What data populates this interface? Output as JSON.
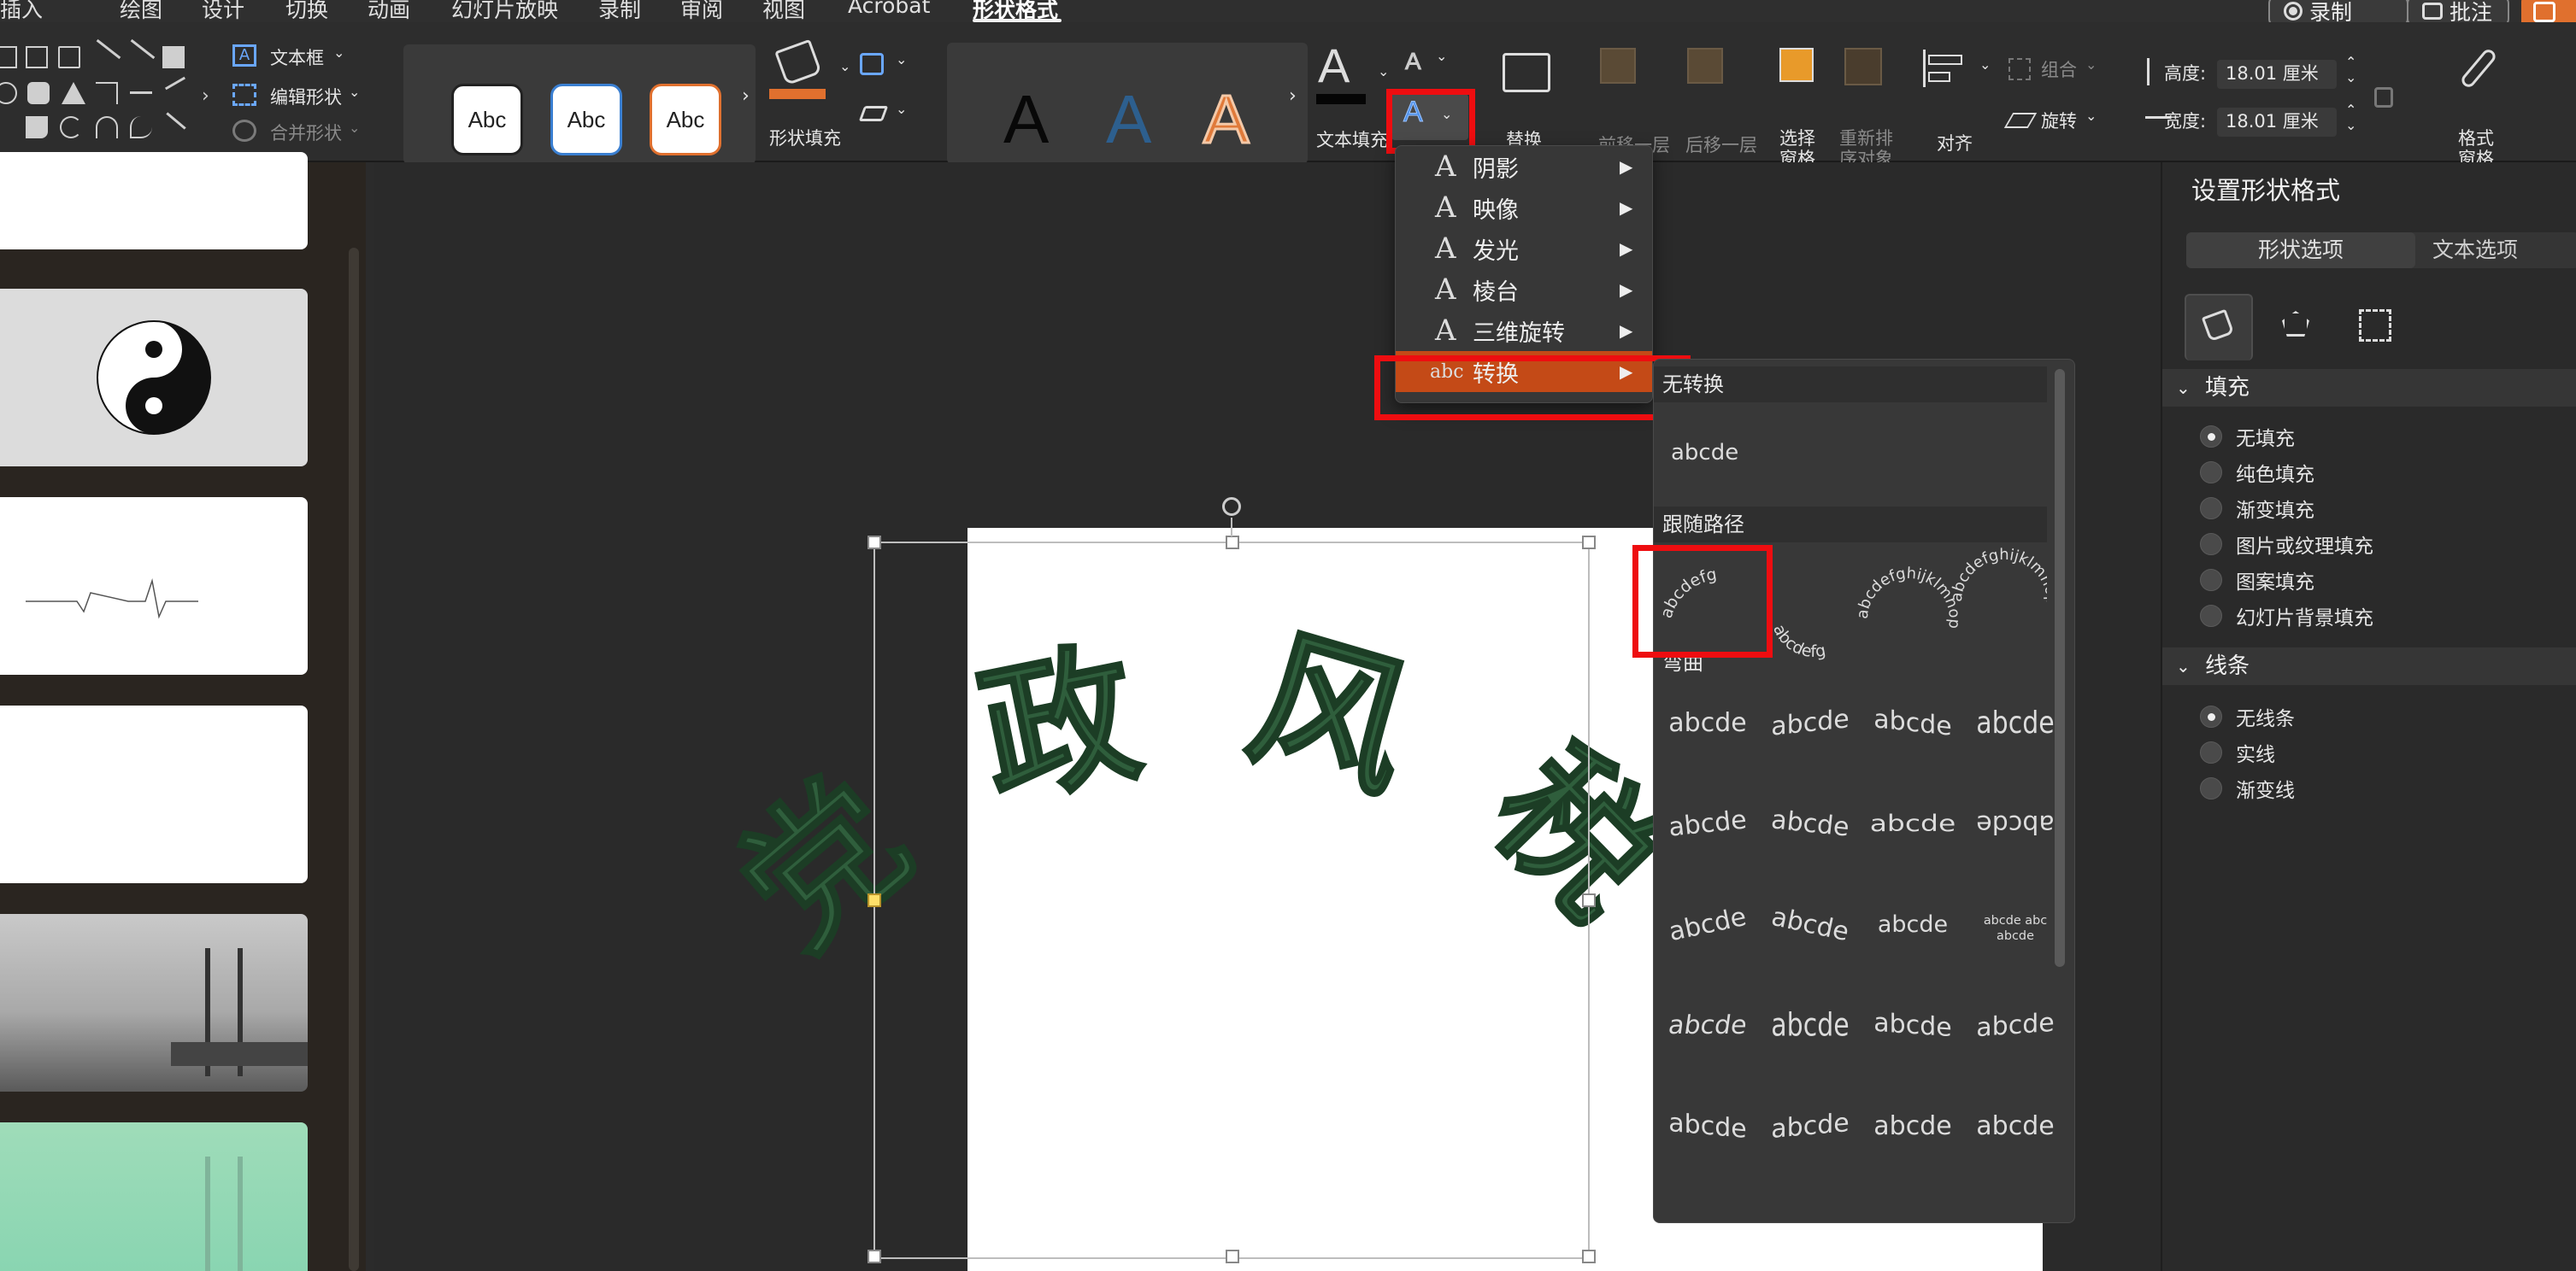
{
  "menu": {
    "tabs": [
      "插入",
      "绘图",
      "设计",
      "切换",
      "动画",
      "幻灯片放映",
      "录制",
      "审阅",
      "视图",
      "Acrobat",
      "形状格式"
    ],
    "active_tab": "形状格式",
    "record_label": "录制",
    "comment_label": "批注"
  },
  "ribbon": {
    "text_box_label": "文本框",
    "edit_shape_label": "编辑形状",
    "merge_shape_label": "合并形状",
    "shape_style_sample": "Abc",
    "shape_fill_label": "形状填充",
    "text_fill_label": "文本填充",
    "wordart_sample": "A",
    "replace_text_label": "替换\n文本",
    "bring_forward_label": "前移一层",
    "send_backward_label": "后移一层",
    "select_pane_label": "选择\n窗格",
    "reorder_label": "重新排\n序对象",
    "align_label": "对齐",
    "group_label": "组合",
    "rotate_label": "旋转",
    "height_label": "高度:",
    "height_value": "18.01 厘米",
    "width_label": "宽度:",
    "width_value": "18.01 厘米",
    "format_pane_label": "格式\n窗格",
    "accent_orange": "#e0702e"
  },
  "text_effects_menu": {
    "items": [
      {
        "label": "阴影",
        "icon": "A"
      },
      {
        "label": "映像",
        "icon": "A"
      },
      {
        "label": "发光",
        "icon": "A"
      },
      {
        "label": "棱台",
        "icon": "A"
      },
      {
        "label": "三维旋转",
        "icon": "A"
      },
      {
        "label": "转换",
        "icon": "abc"
      }
    ],
    "highlight_color": "#c44a17"
  },
  "transform_menu": {
    "no_transform_header": "无转换",
    "no_transform_sample": "abcde",
    "follow_path_header": "跟随路径",
    "follow_path_samples": [
      "abcdefg",
      "abcdefg",
      "abcdefghijklmnop",
      "abcdefghijklmnop"
    ],
    "warp_header": "弯曲",
    "warp_rows": [
      [
        "abcde",
        "abcde",
        "abcde",
        "abcde"
      ],
      [
        "abcde",
        "abcde",
        "abcde",
        "abcde"
      ],
      [
        "abcde",
        "abcde",
        "abcde",
        "abcde abc abcde"
      ],
      [
        "abcde",
        "abcde",
        "abcde",
        "abcde"
      ],
      [
        "abcde",
        "abcde",
        "abcde",
        "abcde"
      ]
    ]
  },
  "slide": {
    "arc_text": "党政风税"
  },
  "format_pane": {
    "title": "设置形状格式",
    "tab_shape": "形状选项",
    "tab_text": "文本选项",
    "fill_header": "填充",
    "fill_options": [
      "无填充",
      "纯色填充",
      "渐变填充",
      "图片或纹理填充",
      "图案填充",
      "幻灯片背景填充"
    ],
    "fill_selected": "无填充",
    "line_header": "线条",
    "line_options": [
      "无线条",
      "实线",
      "渐变线"
    ],
    "line_selected": "无线条"
  },
  "colors": {
    "highlight_red": "#ee0d10",
    "arc_green": "#2f5e3c"
  }
}
